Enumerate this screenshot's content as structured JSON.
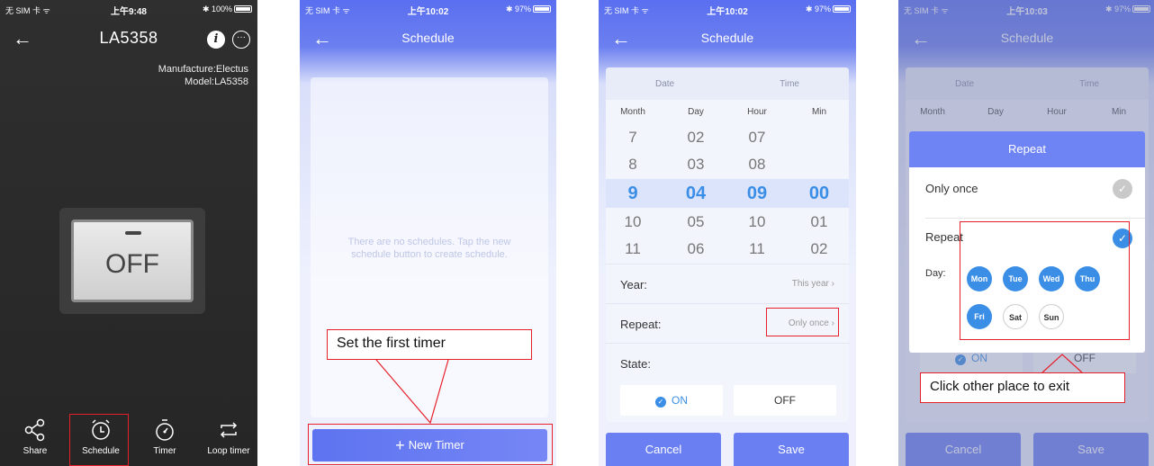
{
  "colors": {
    "accent": "#3a8ee6",
    "annotation_red": "#e6202a",
    "header_blue": "#6f84f4"
  },
  "status_bar": {
    "p1": {
      "carrier": "无 SIM 卡 ᯤ",
      "time": "上午9:48",
      "battery": "✱ 100%"
    },
    "p2": {
      "carrier": "无 SIM 卡 ᯤ",
      "time": "上午10:02",
      "battery": "✱ 97%"
    },
    "p3": {
      "carrier": "无 SIM 卡 ᯤ",
      "time": "上午10:02",
      "battery": "✱ 97%"
    },
    "p4": {
      "carrier": "无 SIM 卡 ᯤ",
      "time": "上午10:03",
      "battery": "✱ 97%"
    }
  },
  "device": {
    "title": "LA5358",
    "manufacture": "Manufacture:Electus",
    "model": "Model:LA5358",
    "switch_state": "OFF",
    "tabs": [
      {
        "label": "Share",
        "icon": "share-icon"
      },
      {
        "label": "Schedule",
        "icon": "alarm-clock-icon"
      },
      {
        "label": "Timer",
        "icon": "stopwatch-icon"
      },
      {
        "label": "Loop timer",
        "icon": "loop-icon"
      }
    ]
  },
  "schedule_list": {
    "title": "Schedule",
    "empty_text": "There are no schedules. Tap the new schedule button to create schedule.",
    "new_timer_label": "New Timer",
    "callout": "Set the first timer"
  },
  "schedule_edit": {
    "title": "Schedule",
    "date_label": "Date",
    "time_label": "Time",
    "columns": [
      "Month",
      "Day",
      "Hour",
      "Min"
    ],
    "rows": [
      [
        "7",
        "02",
        "07",
        ""
      ],
      [
        "8",
        "03",
        "08",
        ""
      ],
      [
        "9",
        "04",
        "09",
        "00"
      ],
      [
        "10",
        "05",
        "10",
        "01"
      ],
      [
        "11",
        "06",
        "11",
        "02"
      ]
    ],
    "year_label": "Year:",
    "year_value": "This year",
    "repeat_label": "Repeat:",
    "repeat_value": "Only once",
    "state_label": "State:",
    "on_label": "ON",
    "off_label": "OFF",
    "cancel_label": "Cancel",
    "save_label": "Save"
  },
  "repeat_dialog": {
    "title": "Repeat",
    "only_once": "Only once",
    "repeat": "Repeat",
    "day_label": "Day:",
    "days": [
      {
        "name": "Mon",
        "selected": true
      },
      {
        "name": "Tue",
        "selected": true
      },
      {
        "name": "Wed",
        "selected": true
      },
      {
        "name": "Thu",
        "selected": true
      },
      {
        "name": "Fri",
        "selected": true
      },
      {
        "name": "Sat",
        "selected": false
      },
      {
        "name": "Sun",
        "selected": false
      }
    ],
    "callout": "Click other place to exit"
  }
}
